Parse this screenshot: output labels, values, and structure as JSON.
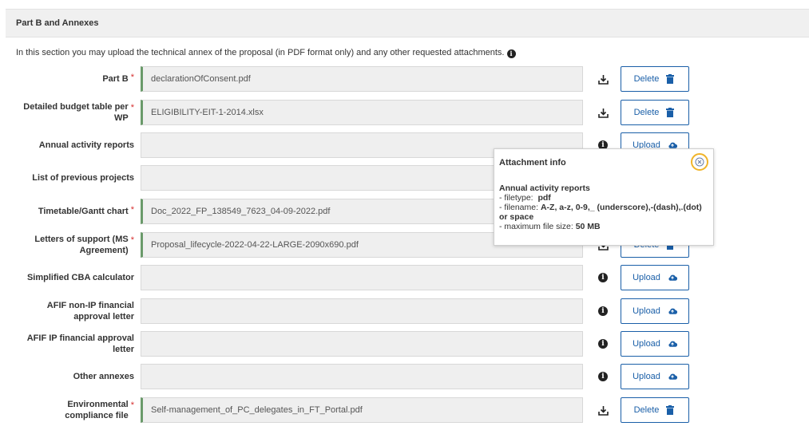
{
  "section": {
    "title": "Part B and Annexes",
    "intro": "In this section you may upload the technical annex of the proposal (in PDF format only) and any other requested attachments."
  },
  "rows": [
    {
      "label": "Part B",
      "required": "*",
      "file": "declarationOfConsent.pdf",
      "icon": "download-icon",
      "button": "Delete",
      "button_icon": "trash-icon"
    },
    {
      "label": "Detailed budget table per WP",
      "required": "*",
      "file": "ELIGIBILITY-EIT-1-2014.xlsx",
      "icon": "download-icon",
      "button": "Delete",
      "button_icon": "trash-icon"
    },
    {
      "label": "Annual activity reports",
      "required": "",
      "file": "",
      "icon": "info-icon",
      "button": "Upload",
      "button_icon": "cloud-upload-icon"
    },
    {
      "label": "List of previous projects",
      "required": "",
      "file": "",
      "icon": "info-icon",
      "button": "Upload",
      "button_icon": "cloud-upload-icon"
    },
    {
      "label": "Timetable/Gantt chart",
      "required": "*",
      "file": "Doc_2022_FP_138549_7623_04-09-2022.pdf",
      "icon": "download-icon",
      "button": "Delete",
      "button_icon": "trash-icon"
    },
    {
      "label": "Letters of support (MS Agreement)",
      "required": "*",
      "file": "Proposal_lifecycle-2022-04-22-LARGE-2090x690.pdf",
      "icon": "download-icon",
      "button": "Delete",
      "button_icon": "trash-icon"
    },
    {
      "label": "Simplified CBA calculator",
      "required": "",
      "file": "",
      "icon": "info-icon",
      "button": "Upload",
      "button_icon": "cloud-upload-icon"
    },
    {
      "label": "AFIF non-IP financial approval letter",
      "required": "",
      "file": "",
      "icon": "info-icon",
      "button": "Upload",
      "button_icon": "cloud-upload-icon"
    },
    {
      "label": "AFIF IP financial approval letter",
      "required": "",
      "file": "",
      "icon": "info-icon",
      "button": "Upload",
      "button_icon": "cloud-upload-icon"
    },
    {
      "label": "Other annexes",
      "required": "",
      "file": "",
      "icon": "info-icon",
      "button": "Upload",
      "button_icon": "cloud-upload-icon"
    },
    {
      "label": "Environmental compliance file",
      "required": "*",
      "file": "Self-management_of_PC_delegates_in_FT_Portal.pdf",
      "icon": "download-icon",
      "button": "Delete",
      "button_icon": "trash-icon"
    }
  ],
  "popup": {
    "title": "Attachment info",
    "heading": "Annual activity reports",
    "filetype_label": "- filetype:",
    "filetype_value": "pdf",
    "filename_label": "- filename:",
    "filename_value": "A-Z, a-z, 0-9,_ (underscore),-(dash),.(dot) or space",
    "maxsize_label": "- maximum file size:",
    "maxsize_value": "50 MB"
  },
  "colors": {
    "button_blue": "#1a5fa8",
    "required_red": "#d62f2f",
    "field_accent_green": "#6a9a6a",
    "close_ring_yellow": "#f0b429"
  }
}
